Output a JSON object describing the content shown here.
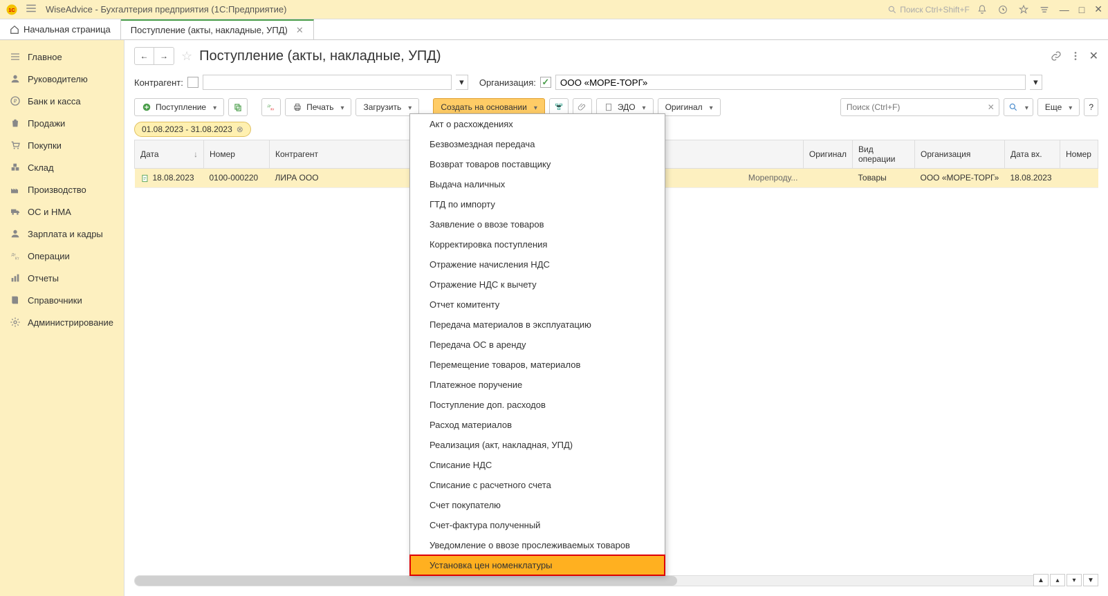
{
  "header": {
    "app_title": "WiseAdvice - Бухгалтерия предприятия  (1С:Предприятие)",
    "search_placeholder": "Поиск Ctrl+Shift+F"
  },
  "tabs": [
    {
      "label": "Начальная страница",
      "closable": false
    },
    {
      "label": "Поступление (акты, накладные, УПД)",
      "closable": true,
      "active": true
    }
  ],
  "sidebar": {
    "items": [
      {
        "label": "Главное"
      },
      {
        "label": "Руководителю"
      },
      {
        "label": "Банк и касса"
      },
      {
        "label": "Продажи"
      },
      {
        "label": "Покупки"
      },
      {
        "label": "Склад"
      },
      {
        "label": "Производство"
      },
      {
        "label": "ОС и НМА"
      },
      {
        "label": "Зарплата и кадры"
      },
      {
        "label": "Операции"
      },
      {
        "label": "Отчеты"
      },
      {
        "label": "Справочники"
      },
      {
        "label": "Администрирование"
      }
    ]
  },
  "page": {
    "title": "Поступление (акты, накладные, УПД)",
    "kontragent_label": "Контрагент:",
    "org_label": "Организация:",
    "org_value": "ООО «МОРЕ-ТОРГ»"
  },
  "toolbar": {
    "postuplenie": "Поступление",
    "print": "Печать",
    "zagruzit": "Загрузить",
    "sozdat_na_osnovanii": "Создать на основании",
    "edo": "ЭДО",
    "original": "Оригинал",
    "search_placeholder": "Поиск (Ctrl+F)",
    "more": "Еще",
    "help": "?"
  },
  "date_chip": "01.08.2023 - 31.08.2023",
  "table": {
    "headers": {
      "date": "Дата",
      "number": "Номер",
      "kontragent": "Контрагент",
      "original": "Оригинал",
      "operation_type": "Вид операции",
      "organization": "Организация",
      "date_in": "Дата вх.",
      "number_in": "Номер"
    },
    "rows": [
      {
        "date": "18.08.2023",
        "number": "0100-000220",
        "kontragent": "ЛИРА ООО",
        "extra": "Морепроду...",
        "original": "",
        "operation_type": "Товары",
        "organization": "ООО «МОРЕ-ТОРГ»",
        "date_in": "18.08.2023"
      }
    ]
  },
  "dropdown": {
    "items": [
      "Акт о расхождениях",
      "Безвозмездная передача",
      "Возврат товаров поставщику",
      "Выдача наличных",
      "ГТД по импорту",
      "Заявление о ввозе товаров",
      "Корректировка поступления",
      "Отражение начисления НДС",
      "Отражение НДС к вычету",
      "Отчет комитенту",
      "Передача материалов в эксплуатацию",
      "Передача ОС в аренду",
      "Перемещение товаров, материалов",
      "Платежное поручение",
      "Поступление доп. расходов",
      "Расход материалов",
      "Реализация (акт, накладная, УПД)",
      "Списание НДС",
      "Списание с расчетного счета",
      "Счет покупателю",
      "Счет-фактура полученный",
      "Уведомление о ввозе прослеживаемых товаров",
      "Установка цен номенклатуры"
    ],
    "highlighted_index": 22
  }
}
